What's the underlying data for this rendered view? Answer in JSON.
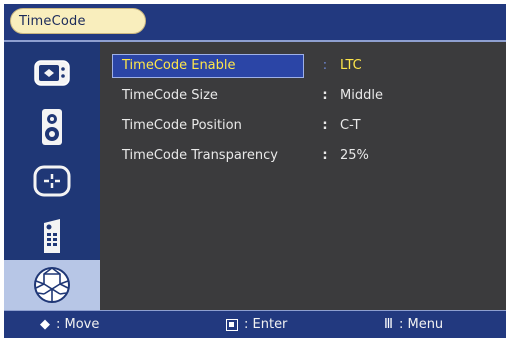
{
  "header": {
    "title": "TimeCode"
  },
  "sidebar": {
    "items": [
      {
        "icon": "picture-settings-icon",
        "active": false
      },
      {
        "icon": "speaker-audio-icon",
        "active": false
      },
      {
        "icon": "position-adjust-icon",
        "active": false
      },
      {
        "icon": "remote-control-icon",
        "active": false
      },
      {
        "icon": "timecode-globe-icon",
        "active": true
      }
    ]
  },
  "menu": {
    "rows": [
      {
        "label": "TimeCode Enable",
        "value": "LTC",
        "selected": true
      },
      {
        "label": "TimeCode Size",
        "value": "Middle",
        "selected": false
      },
      {
        "label": "TimeCode Position",
        "value": "C-T",
        "selected": false
      },
      {
        "label": "TimeCode Transparency",
        "value": "25%",
        "selected": false
      }
    ],
    "separator": ":"
  },
  "footer": {
    "move": {
      "symbol": "◆",
      "label": ": Move"
    },
    "enter": {
      "label": ": Enter"
    },
    "menu": {
      "symbol": "Ⅲ",
      "label": ": Menu"
    }
  },
  "colors": {
    "panel": "#3b3b3d",
    "bar": "#22397f",
    "selected_text": "#ffe74a",
    "highlight": "#2b45a6"
  }
}
